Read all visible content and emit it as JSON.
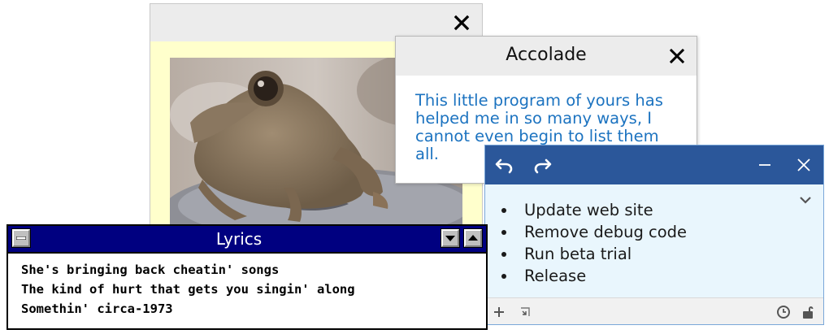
{
  "accolade": {
    "title": "Accolade",
    "message": "This little program of yours has helped me in so many ways, I cannot even begin to list them all."
  },
  "todo": {
    "items": [
      "Update web site",
      "Remove debug code",
      "Run beta trial",
      "Release"
    ]
  },
  "lyrics": {
    "title": "Lyrics",
    "lines": [
      "She's bringing back cheatin' songs",
      "The kind of hurt that gets you singin' along",
      "Somethin' circa-1973"
    ]
  },
  "colors": {
    "accolade_text": "#1c73c0",
    "todo_titlebar": "#2b579a",
    "todo_background": "#e9f6fd",
    "lyrics_titlebar": "#000080",
    "photo_mat": "#ffffcc"
  },
  "icons": {
    "frog_window": [
      "close-icon"
    ],
    "accolade_window": [
      "close-icon"
    ],
    "todo_window": [
      "undo-icon",
      "redo-icon",
      "minimize-icon",
      "close-icon",
      "chevron-down-icon",
      "plus-icon",
      "resize-icon",
      "clock-icon",
      "unlock-icon"
    ],
    "lyrics_window": [
      "system-menu-icon",
      "minimize-icon",
      "maximize-icon"
    ]
  }
}
